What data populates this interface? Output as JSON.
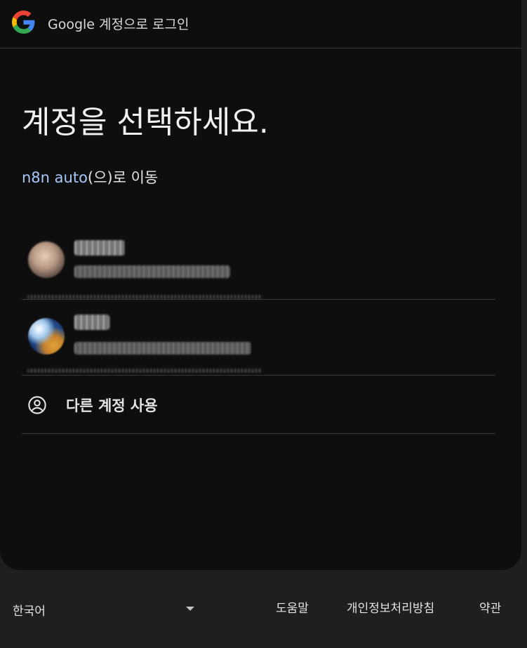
{
  "header": {
    "title": "Google 계정으로 로그인",
    "logo_icon": "google-g-icon",
    "colors": {
      "blue": "#4285F4",
      "red": "#EA4335",
      "yellow": "#FBBC05",
      "green": "#34A853"
    }
  },
  "main": {
    "headline": "계정을 선택하세요.",
    "continue_app": "n8n auto",
    "continue_suffix": "(으)로 이동",
    "app_link_color": "#a8c7fa"
  },
  "accounts": [
    {
      "avatar_icon": "profile-photo"
    },
    {
      "avatar_icon": "profile-photo"
    }
  ],
  "use_another": {
    "icon": "account-circle-icon",
    "label": "다른 계정 사용"
  },
  "footer": {
    "language": "한국어",
    "language_dropdown_icon": "caret-down-icon",
    "links": {
      "help": "도움말",
      "privacy": "개인정보처리방침",
      "terms": "약관"
    }
  },
  "theme": {
    "card_background": "#0e0e0e",
    "page_background": "#1f1f1f",
    "divider": "#3b3b3b",
    "text_primary": "#e3e3e3"
  }
}
